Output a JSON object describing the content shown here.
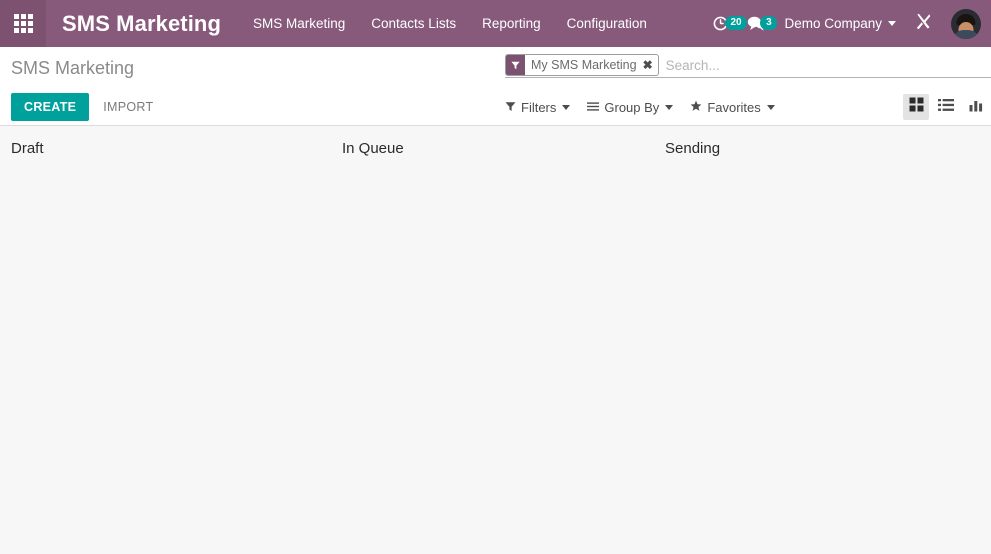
{
  "navbar": {
    "apps_icon": "apps-grid-icon",
    "brand": "SMS Marketing",
    "menu": [
      {
        "label": "SMS Marketing"
      },
      {
        "label": "Contacts Lists"
      },
      {
        "label": "Reporting"
      },
      {
        "label": "Configuration"
      }
    ],
    "activity": {
      "icon": "clock-activity-icon",
      "count": "20"
    },
    "messages": {
      "icon": "chat-bubble-icon",
      "count": "3"
    },
    "company": {
      "label": "Demo Company",
      "icon": "chevron-down-icon"
    },
    "tools": {
      "icon": "developer-tools-icon"
    },
    "avatar": {
      "icon": "user-avatar"
    }
  },
  "control_panel": {
    "breadcrumb": "SMS Marketing",
    "create_label": "CREATE",
    "import_label": "IMPORT",
    "search": {
      "facet_label": "My SMS Marketing",
      "facet_icon": "filter-funnel-icon",
      "facet_close_icon": "close-icon",
      "placeholder": "Search..."
    },
    "filters": [
      {
        "label": "Filters",
        "icon": "filter-funnel-icon"
      },
      {
        "label": "Group By",
        "icon": "bars-icon"
      },
      {
        "label": "Favorites",
        "icon": "star-icon"
      }
    ],
    "views": [
      {
        "name": "kanban",
        "icon": "kanban-view-icon",
        "active": true
      },
      {
        "name": "list",
        "icon": "list-view-icon",
        "active": false
      },
      {
        "name": "graph",
        "icon": "graph-view-icon",
        "active": false
      }
    ]
  },
  "kanban": {
    "columns": [
      {
        "title": "Draft",
        "records": []
      },
      {
        "title": "In Queue",
        "records": []
      },
      {
        "title": "Sending",
        "records": []
      }
    ]
  },
  "colors": {
    "brand_purple": "#875A7B",
    "accent_teal": "#00A09D",
    "page_background": "#f7f7f7"
  }
}
